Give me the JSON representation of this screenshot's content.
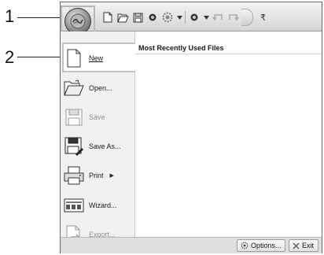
{
  "callouts": {
    "one": "1",
    "two": "2"
  },
  "quick_access": {
    "icons": [
      "new-doc-icon",
      "open-folder-icon",
      "save-icon",
      "record-icon",
      "settings-icon",
      "dropdown-icon",
      "record-icon",
      "dropdown-icon",
      "undo-icon",
      "redo-icon"
    ],
    "more": "₹"
  },
  "menu": {
    "header": "Most Recently Used Files",
    "commands": [
      {
        "label": "New",
        "underline": "N",
        "icon": "new-document-icon",
        "enabled": true
      },
      {
        "label": "Open...",
        "underline": "O",
        "icon": "open-folder-icon",
        "enabled": true
      },
      {
        "label": "Save",
        "underline": "S",
        "icon": "save-icon",
        "enabled": false
      },
      {
        "label": "Save As...",
        "underline": "A",
        "icon": "save-as-icon",
        "enabled": true
      },
      {
        "label": "Print",
        "underline": "P",
        "icon": "print-icon",
        "enabled": true
      },
      {
        "label": "Wizard...",
        "underline": "z",
        "icon": "wizard-icon",
        "enabled": true
      },
      {
        "label": "Export...",
        "underline": "E",
        "icon": "export-icon",
        "enabled": false
      }
    ]
  },
  "buttons": {
    "options": "Options...",
    "exit": "Exit"
  },
  "colors": {
    "frame": "#6a6a6a",
    "menu_bg": "#f1f1f1",
    "highlight_border": "#c2c2c2"
  }
}
